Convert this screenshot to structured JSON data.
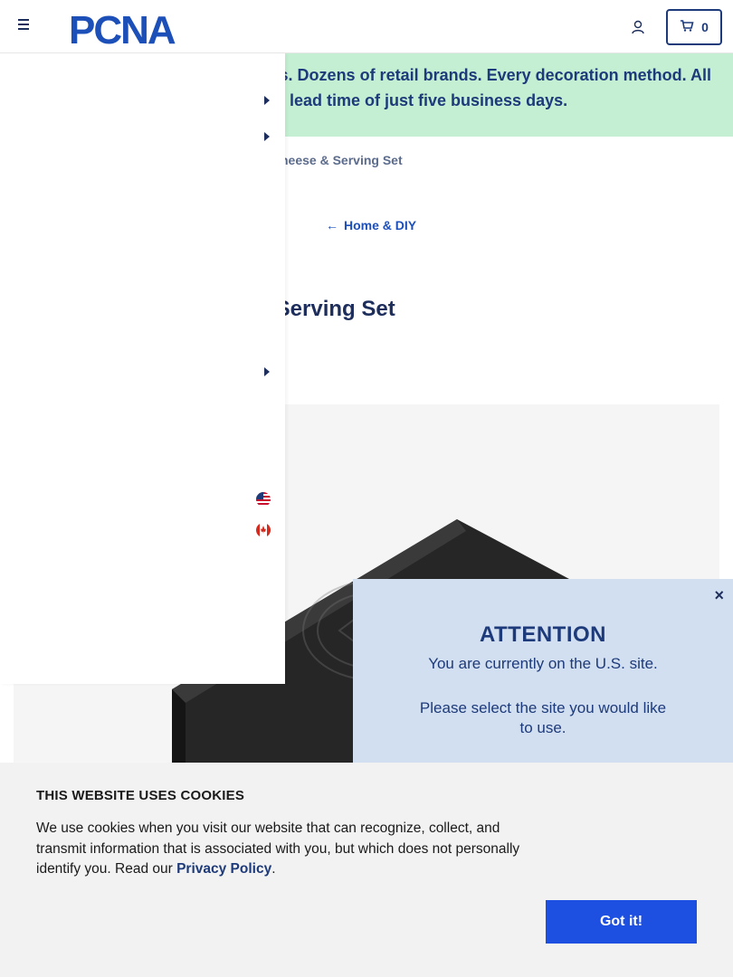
{
  "header": {
    "logo_text": "PCNA",
    "cart_count": "0",
    "icons": {
      "menu": "hamburger-icon",
      "account": "user-icon",
      "cart": "cart-icon"
    }
  },
  "promo": {
    "line1": "s. Dozens of retail brands. Every decoration method. All",
    "line2": "lead time of just five business days."
  },
  "breadcrumb": {
    "current": "heese & Serving Set"
  },
  "back_link": {
    "label": "Home & DIY"
  },
  "product": {
    "title": ": Serving Set"
  },
  "drawer": {
    "caret_icon": "caret-right-icon",
    "flags": [
      "us-flag-icon",
      "canada-flag-icon"
    ]
  },
  "attention": {
    "title": "ATTENTION",
    "line1": "You are currently on the U.S. site.",
    "line2": "Please select the site you would like to use.",
    "close_symbol": "×"
  },
  "cookies": {
    "title": "THIS WEBSITE USES COOKIES",
    "body_before": "We use cookies when you visit our website that can recognize, collect, and transmit information that is associated with you, but which does not personally identify you. Read our ",
    "link_label": "Privacy Policy",
    "body_after": ".",
    "button_label": "Got it!"
  },
  "colors": {
    "navy": "#1d2d5c",
    "brand_blue": "#1d4fb8",
    "promo_bg": "#c4efd2",
    "attention_bg": "#d2dff1",
    "cookie_button": "#1d4fe0"
  }
}
